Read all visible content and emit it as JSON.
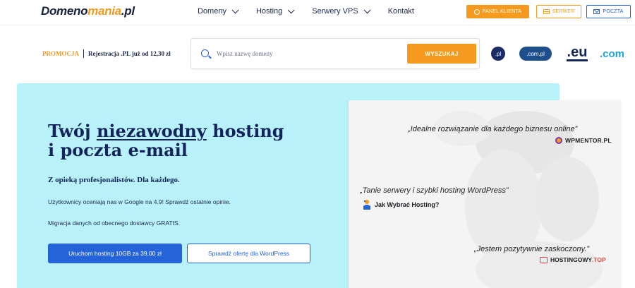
{
  "header": {
    "logo_main": "Domeno",
    "logo_accent": "mania",
    "logo_tld": ".pl",
    "nav": [
      {
        "label": "Domeny",
        "has_dropdown": true
      },
      {
        "label": "Hosting",
        "has_dropdown": true
      },
      {
        "label": "Serwery VPS",
        "has_dropdown": true
      },
      {
        "label": "Kontakt",
        "has_dropdown": false
      }
    ],
    "panel_label": "PANEL KLIENTA",
    "serwer_label": "SERWER",
    "poczta_label": "POCZTA"
  },
  "search": {
    "promo_tag": "PROMOCJA",
    "promo_text": "Rejestracja .PL już od 12,30 zł",
    "placeholder": "Wpisz nazwę domeny",
    "button_label": "WYSZUKAJ",
    "tlds": [
      ".pl",
      ".com.pl",
      ".eu",
      ".com"
    ]
  },
  "hero": {
    "title_pre": "Twój ",
    "title_underlined": "niezawodny",
    "title_post": " hosting",
    "title_line2": "i poczta e-mail",
    "subtitle": "Z opieką profesjonalistów. Dla każdego.",
    "line1": "Użytkownicy oceniają nas w Google na 4.9! Sprawdź ostatnie opinie.",
    "line2": "Migracja danych od obecnego dostawcy GRATIS.",
    "cta_primary": "Uruchom hosting 10GB za 39,00 zł",
    "cta_secondary": "Sprawdź ofertę dla WordPress"
  },
  "testimonials": [
    {
      "quote": "„Idealne rozwiązanie dla każdego biznesu online”",
      "source": "WPMENTOR.PL"
    },
    {
      "quote": "„Tanie serwery i szybki hosting WordPress”",
      "source": "Jak Wybrać Hosting?"
    },
    {
      "quote": "„Jestem pozytywnie zaskoczony.”",
      "source_main": "HOSTINGOWY",
      "source_accent": ".TOP"
    }
  ],
  "colors": {
    "accent_orange": "#f59a1e",
    "primary_blue": "#2563d9",
    "navy": "#12245a",
    "hero_bg": "#b8f1f9"
  }
}
